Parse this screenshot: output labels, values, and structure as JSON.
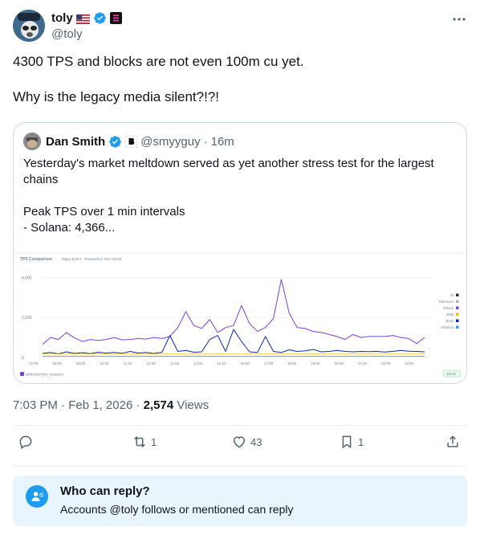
{
  "author": {
    "name": "toly",
    "handle": "@toly",
    "flag": "US flag",
    "badges": [
      "verified-icon",
      "org-badge-icon"
    ]
  },
  "tweet": {
    "line1": "4300 TPS and blocks are not even 100m cu yet.",
    "line2": "Why is the legacy media silent?!?!"
  },
  "quote": {
    "name": "Dan Smith",
    "handle": "@smyyguy",
    "dot": "·",
    "time": "16m",
    "text1": "Yesterday's market meltdown served as yet another stress test for the largest chains",
    "text2": "Peak TPS over 1 min intervals",
    "text3": "- Solana: 4,366..."
  },
  "chart_data": {
    "type": "line",
    "title": "TPS Comparison",
    "subtitle": "Major Event - Transaction Fee Check",
    "y_ticks": [
      "4,000",
      "2,000",
      "0"
    ],
    "ylim": [
      0,
      4500
    ],
    "x_ticks": [
      "07:00",
      "08:00",
      "09:00",
      "10:00",
      "11:00",
      "12:00",
      "13:00",
      "14:00",
      "15:00",
      "16:00",
      "17:00",
      "18:00",
      "19:00",
      "20:00",
      "21:00",
      "22:00",
      "23:00"
    ],
    "legend": [
      "All",
      "Ethereum",
      "Solana",
      "BNB",
      "Base",
      "Arbitrum"
    ],
    "legend_colors": [
      "#333333",
      "#b0b7c3",
      "#7b3fe4",
      "#f0b90b",
      "#0a28c8",
      "#28a0f0"
    ],
    "series": [
      {
        "name": "Solana",
        "color": "#7b3fe4",
        "values": [
          650,
          1000,
          900,
          1250,
          980,
          800,
          900,
          850,
          900,
          1000,
          880,
          900,
          950,
          920,
          1000,
          950,
          1050,
          1500,
          2300,
          1600,
          1450,
          1900,
          1250,
          1500,
          1600,
          2600,
          1700,
          1300,
          1500,
          1950,
          3900,
          2200,
          1500,
          1450,
          1300,
          1250,
          1150,
          1050,
          900,
          1150,
          1000,
          1050,
          1050,
          1050,
          1100,
          1000,
          950,
          700,
          1000
        ]
      },
      {
        "name": "Base",
        "color": "#0a28c8",
        "values": [
          200,
          250,
          180,
          280,
          200,
          240,
          190,
          260,
          220,
          250,
          210,
          300,
          220,
          250,
          200,
          260,
          1100,
          300,
          350,
          260,
          280,
          900,
          1100,
          300,
          1400,
          800,
          280,
          250,
          1050,
          300,
          250,
          380,
          300,
          330,
          400,
          280,
          300,
          350,
          300,
          280,
          300,
          290,
          300,
          270,
          300,
          350,
          310,
          300,
          280
        ]
      }
    ],
    "watermark": "@blockworks_research",
    "interval": "10min"
  },
  "meta": {
    "time": "7:03 PM",
    "dot1": "·",
    "date": "Feb 1, 2026",
    "dot2": "·",
    "views_count": "2,574",
    "views_label": "Views"
  },
  "actions": {
    "replies": "",
    "reposts": "1",
    "likes": "43",
    "bookmarks": "1"
  },
  "reply_box": {
    "title": "Who can reply?",
    "subtitle": "Accounts @toly follows or mentioned can reply"
  }
}
